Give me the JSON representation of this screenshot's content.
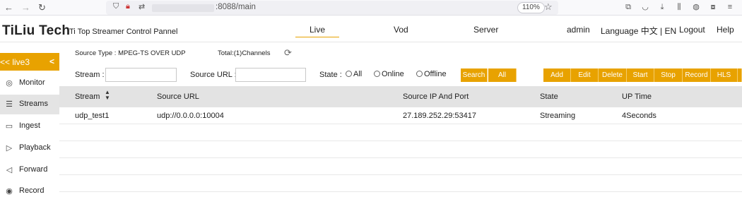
{
  "browser": {
    "url_text": ":8088/main",
    "zoom": "110%"
  },
  "header": {
    "brand": "TiLiu Tech",
    "subtitle": "Ti Top Streamer Control Pannel",
    "nav": [
      "Live",
      "Vod",
      "Server"
    ],
    "active_nav": "Live",
    "user": "admin",
    "language": "Language 中文 | EN",
    "logout": "Logout",
    "help": "Help"
  },
  "sidebar": {
    "title": "<< live3",
    "collapse": "<",
    "items": [
      {
        "label": "Monitor",
        "icon": "monitor-icon",
        "glyph": "◎"
      },
      {
        "label": "Streams",
        "icon": "streams-icon",
        "glyph": "☰"
      },
      {
        "label": "Ingest",
        "icon": "ingest-icon",
        "glyph": "▭"
      },
      {
        "label": "Playback",
        "icon": "playback-icon",
        "glyph": "▷"
      },
      {
        "label": "Forward",
        "icon": "forward-icon",
        "glyph": "◁"
      },
      {
        "label": "Record",
        "icon": "record-icon",
        "glyph": "◉"
      }
    ],
    "active": "Streams"
  },
  "info": {
    "source_type": "Source Type : MPEG-TS OVER UDP",
    "total": "Total:(1)Channels"
  },
  "filters": {
    "stream_label": "Stream :",
    "source_url_label": "Source URL :",
    "state_label": "State :",
    "state_options": [
      "All",
      "Online",
      "Offline"
    ],
    "search_button": "Search",
    "all_button": "All"
  },
  "actions": [
    "Add",
    "Edit",
    "Delete",
    "Start",
    "Stop",
    "Record",
    "HLS"
  ],
  "table": {
    "columns": [
      "Stream",
      "Source URL",
      "Source IP And Port",
      "State",
      "UP Time"
    ],
    "rows": [
      [
        "udp_test1",
        "udp://0.0.0.0:10004",
        "27.189.252.29:53417",
        "Streaming",
        "4Seconds"
      ]
    ]
  },
  "colors": {
    "accent": "#e8a200",
    "header_row": "#e3e3e3",
    "active_side": "#e4e4e4"
  }
}
